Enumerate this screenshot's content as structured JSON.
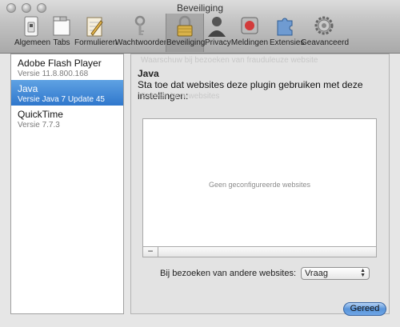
{
  "window": {
    "title": "Beveiliging"
  },
  "toolbar": [
    {
      "label": "Algemeen",
      "icon": "switch-icon"
    },
    {
      "label": "Tabs",
      "icon": "tabs-icon"
    },
    {
      "label": "Formulieren",
      "icon": "pencil-icon"
    },
    {
      "label": "Wachtwoorden",
      "icon": "key-icon"
    },
    {
      "label": "Beveiliging",
      "icon": "lock-icon"
    },
    {
      "label": "Privacy",
      "icon": "person-icon"
    },
    {
      "label": "Meldingen",
      "icon": "record-icon"
    },
    {
      "label": "Extensies",
      "icon": "puzzle-icon"
    },
    {
      "label": "Geavanceerd",
      "icon": "gear-icon"
    }
  ],
  "plugins": [
    {
      "name": "Adobe Flash Player",
      "version": "Versie 11.8.800.168"
    },
    {
      "name": "Java",
      "version": "Versie Java 7 Update 45"
    },
    {
      "name": "QuickTime",
      "version": "Versie 7.7.3"
    }
  ],
  "selected_index": 1,
  "panel": {
    "ghost_1": "Waarschuw bij bezoeken van frauduleuze website",
    "ghost_2": "Sta plug-ins toe",
    "ghost_3": "Beheer Java-websites",
    "title": "Java",
    "description": "Sta toe dat websites deze plugin gebruiken met deze instellingen:",
    "empty_text": "Geen geconfigureerde websites",
    "remove_symbol": "−",
    "other_label": "Bij bezoeken van andere websites:",
    "other_value": "Vraag"
  },
  "done_label": "Gereed",
  "colors": {
    "selection": "#3d84d4",
    "done_button": "#5a95da"
  }
}
